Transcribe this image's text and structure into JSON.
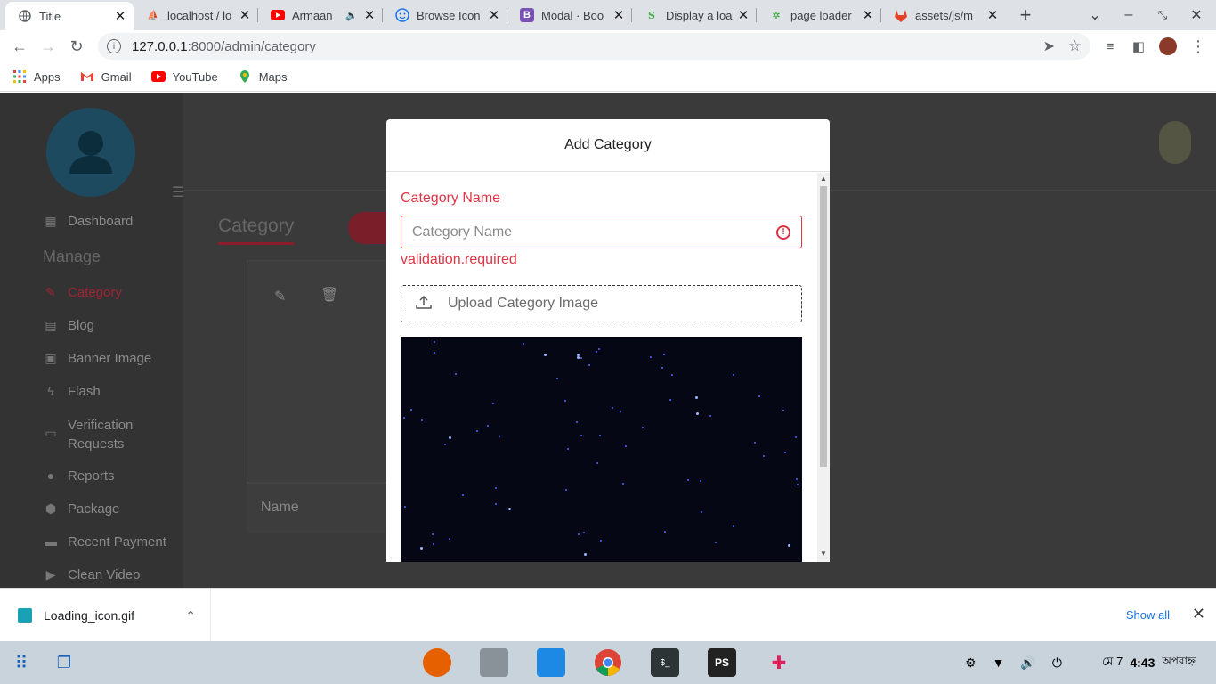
{
  "browser": {
    "tabs": [
      {
        "title": "Title",
        "favicon": "globe-icon",
        "active": true
      },
      {
        "title": "localhost / lo",
        "favicon": "pma-icon"
      },
      {
        "title": "Armaan",
        "favicon": "youtube-icon",
        "audio": true
      },
      {
        "title": "Browse Icon",
        "favicon": "smiley-icon"
      },
      {
        "title": "Modal · Boo",
        "favicon": "bootstrap-icon"
      },
      {
        "title": "Display a loa",
        "favicon": "w3schools-icon"
      },
      {
        "title": "page loader",
        "favicon": "pinwheel-icon"
      },
      {
        "title": "assets/js/m",
        "favicon": "gitlab-icon"
      }
    ],
    "new_tab_label": "+",
    "url_host": "127.0.0.1",
    "url_path": ":8000/admin/category",
    "bookmarks": [
      {
        "label": "Apps",
        "icon": "apps-grid-icon"
      },
      {
        "label": "Gmail",
        "icon": "gmail-icon"
      },
      {
        "label": "YouTube",
        "icon": "youtube-icon"
      },
      {
        "label": "Maps",
        "icon": "maps-icon"
      }
    ]
  },
  "sidebar": {
    "section_label": "Manage",
    "items": [
      {
        "label": "Dashboard",
        "icon": "dashboard-icon"
      },
      {
        "label": "Category",
        "icon": "category-icon",
        "active": true
      },
      {
        "label": "Blog",
        "icon": "blog-icon"
      },
      {
        "label": "Banner Image",
        "icon": "image-icon"
      },
      {
        "label": "Flash",
        "icon": "flash-icon"
      },
      {
        "label": "Verification Requests",
        "icon": "id-card-icon"
      },
      {
        "label": "Reports",
        "icon": "report-icon"
      },
      {
        "label": "Package",
        "icon": "package-icon"
      },
      {
        "label": "Recent Payment",
        "icon": "payment-icon"
      },
      {
        "label": "Clean Video",
        "icon": "video-icon"
      }
    ]
  },
  "main": {
    "page_title": "Category",
    "table_header": "Name"
  },
  "modal": {
    "title": "Add Category",
    "field_label": "Category Name",
    "field_placeholder": "Category Name",
    "field_error": "validation.required",
    "upload_label": "Upload Category Image"
  },
  "downloads": {
    "file_name": "Loading_icon.gif",
    "show_all": "Show all"
  },
  "taskbar": {
    "date": "মে 7",
    "time": "4:43",
    "period": "অপরাহ্ন"
  },
  "colors": {
    "error": "#dc3545",
    "link": "#1a73e8",
    "sidebar_active": "#a02535"
  }
}
